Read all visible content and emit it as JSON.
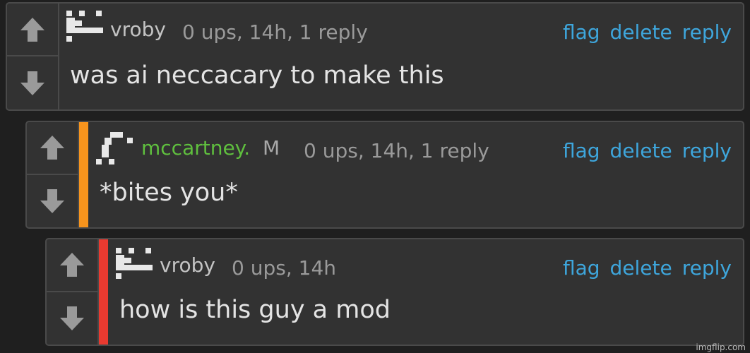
{
  "comments": [
    {
      "username": "vroby",
      "badge": "",
      "meta": "0 ups, 14h, 1 reply",
      "text": "was ai neccacary to make this",
      "actions": {
        "flag": "flag",
        "delete": "delete",
        "reply": "reply"
      },
      "bar_color": ""
    },
    {
      "username": "mccartney.",
      "badge": "M",
      "meta": "0 ups, 14h, 1 reply",
      "text": "*bites you*",
      "actions": {
        "flag": "flag",
        "delete": "delete",
        "reply": "reply"
      },
      "bar_color": "#f7941d"
    },
    {
      "username": "vroby",
      "badge": "",
      "meta": "0 ups, 14h",
      "text": "how is this guy a mod",
      "actions": {
        "flag": "flag",
        "delete": "delete",
        "reply": "reply"
      },
      "bar_color": "#e83a30"
    }
  ],
  "watermark": "imgflip.com",
  "colors": {
    "link": "#3ea6dc",
    "mod_name": "#5fbf3e"
  },
  "icons": [
    "arrow-up-icon",
    "arrow-down-icon",
    "pixel-avatar-icon"
  ]
}
